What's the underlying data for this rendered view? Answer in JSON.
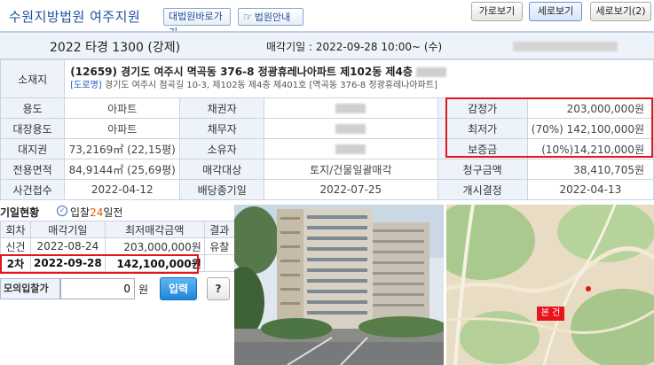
{
  "header": {
    "court_name": "수원지방법원 여주지원",
    "supreme_court_link": "대법원바로가기",
    "court_guide": "법원안내",
    "view_horizontal": "가로보기",
    "view_vertical": "세로보기",
    "view_horizontal_2": "세로보기(2)"
  },
  "case": {
    "case_number": "2022 타경 1300 (강제)",
    "sale_date": "매각기일 : 2022-09-28 10:00~ (수)"
  },
  "property": {
    "labels": {
      "location": "소재지",
      "usage": "용도",
      "ledger_usage": "대장용도",
      "land_right": "대지권",
      "exclusive_area": "전용면적",
      "case_received": "사건접수",
      "creditor": "채권자",
      "debtor": "채무자",
      "owner": "소유자",
      "sale_target": "매각대상",
      "dividend_deadline": "배당종기일",
      "appraisal_price": "감정가",
      "minimum_price": "최저가",
      "deposit": "보증금",
      "claim_amount": "청구금액",
      "start_decision": "개시결정"
    },
    "address_main": "(12659) 경기도 여주시 멱곡동 376-8 정광휴레나아파트 제102동 제4층",
    "road_tag": "[도로명]",
    "address_road": "경기도 여주시 점곡길 10-3, 제102동 제4층 제401호 [멱곡동 376-8 정광휴레나아파트]",
    "usage": "아파트",
    "ledger_usage": "아파트",
    "land_right": "73,2169㎡ (22,15평)",
    "exclusive_area": "84,9144㎡ (25,69평)",
    "case_received": "2022-04-12",
    "sale_target": "토지/건물일괄매각",
    "dividend_deadline": "2022-07-25",
    "appraisal_price": "203,000,000원",
    "minimum_price": "(70%) 142,100,000원",
    "deposit": "(10%)14,210,000원",
    "claim_amount": "38,410,705원",
    "start_decision": "2022-04-13"
  },
  "bid_history": {
    "title": "기일현황",
    "bid_days_prefix": "입찰",
    "bid_days_count": "24",
    "bid_days_suffix": "일전",
    "headers": [
      "회차",
      "매각기일",
      "최저매각금액",
      "결과"
    ],
    "rows": [
      {
        "round": "신건",
        "date": "2022-08-24",
        "price": "203,000,000원",
        "result": "유찰"
      },
      {
        "round": "2차",
        "date": "2022-09-28",
        "price": "142,100,000원",
        "result": ""
      }
    ]
  },
  "mock_bid": {
    "label": "모의입찰가",
    "value": "0",
    "unit": "원",
    "submit": "입력",
    "help": "?"
  },
  "map": {
    "badge": "본 건"
  },
  "colors": {
    "highlight_red": "#e8141b",
    "label_bg": "#eef3fa",
    "court_blue": "#1e4f9b"
  }
}
